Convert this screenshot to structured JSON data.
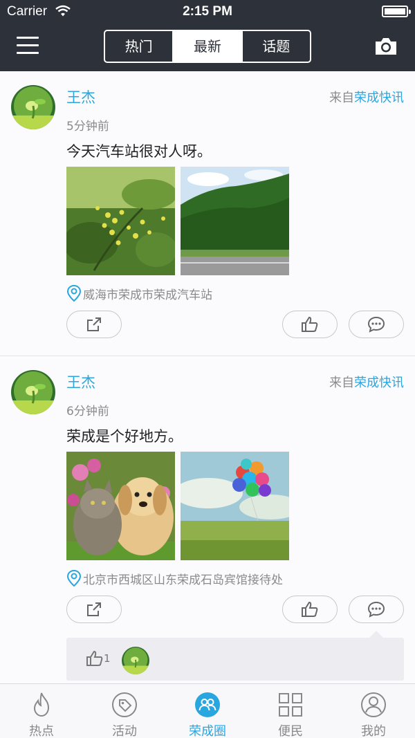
{
  "status_bar": {
    "carrier": "Carrier",
    "time": "2:15 PM"
  },
  "nav": {
    "segments": [
      {
        "label": "热门",
        "active": false
      },
      {
        "label": "最新",
        "active": true
      },
      {
        "label": "话题",
        "active": false
      }
    ]
  },
  "posts": [
    {
      "author": "王杰",
      "source_prefix": "来自",
      "source_name": "荣成快讯",
      "time_ago": "5分钟前",
      "text": "今天汽车站很对人呀。",
      "location": "威海市荣成市荣成汽车站"
    },
    {
      "author": "王杰",
      "source_prefix": "来自",
      "source_name": "荣成快讯",
      "time_ago": "6分钟前",
      "text": "荣成是个好地方。",
      "location": "北京市西城区山东荣成石岛宾馆接待处",
      "like_count": "1"
    }
  ],
  "tabs": [
    {
      "label": "热点",
      "icon": "flame-icon"
    },
    {
      "label": "活动",
      "icon": "tag-icon"
    },
    {
      "label": "荣成圈",
      "icon": "people-icon",
      "active": true
    },
    {
      "label": "便民",
      "icon": "grid-icon"
    },
    {
      "label": "我的",
      "icon": "user-icon"
    }
  ],
  "colors": {
    "accent": "#27a6e0",
    "navbar": "#2c313a",
    "muted": "#8a8a8a"
  }
}
